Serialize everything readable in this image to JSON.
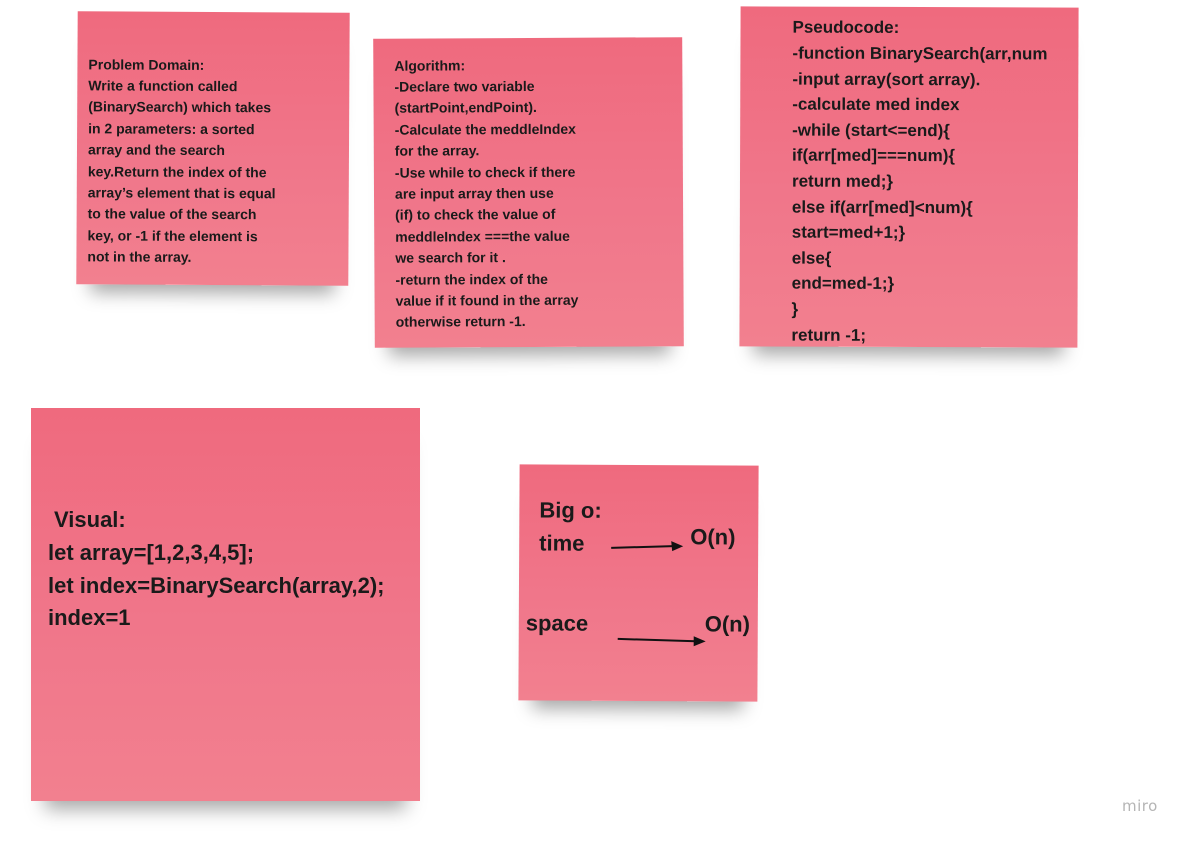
{
  "problem_domain": {
    "heading": "Problem Domain:",
    "lines": [
      "Write a function called",
      "(BinarySearch) which takes",
      "in 2 parameters: a sorted",
      "array and the search",
      "key.Return the index of the",
      "array’s element that is equal",
      "to the value of the search",
      "key, or -1 if the element is",
      "not in the array."
    ]
  },
  "algorithm": {
    "heading": "Algorithm:",
    "lines": [
      "-Declare two variable",
      "(startPoint,endPoint).",
      "-Calculate the meddleIndex",
      "for the array.",
      "-Use while to check if there",
      "are input array then use",
      "(if) to check the value of",
      "meddleIndex ===the value",
      "we search for it  .",
      "-return the index of the",
      "value if it found in the array",
      "otherwise return -1."
    ]
  },
  "pseudocode": {
    "heading": "Pseudocode:",
    "lines": [
      "-function BinarySearch(arr,num",
      "-input array(sort array).",
      "-calculate med index",
      "-while (start<=end){",
      "if(arr[med]===num){",
      "return med;}",
      "else if(arr[med]<num){",
      "start=med+1;}",
      "else{",
      "end=med-1;}",
      "}",
      "return -1;"
    ]
  },
  "visual": {
    "heading": "Visual:",
    "lines": [
      "let array=[1,2,3,4,5];",
      "let index=BinarySearch(array,2);",
      "index=1"
    ]
  },
  "big_o": {
    "heading": "Big o:",
    "time_label": "time",
    "time_value": "O(n)",
    "space_label": "space",
    "space_value": "O(n)"
  },
  "watermark": "miro",
  "colors": {
    "sticky_note": "#f0768a",
    "text": "#1a1a1a",
    "background": "#ffffff"
  }
}
